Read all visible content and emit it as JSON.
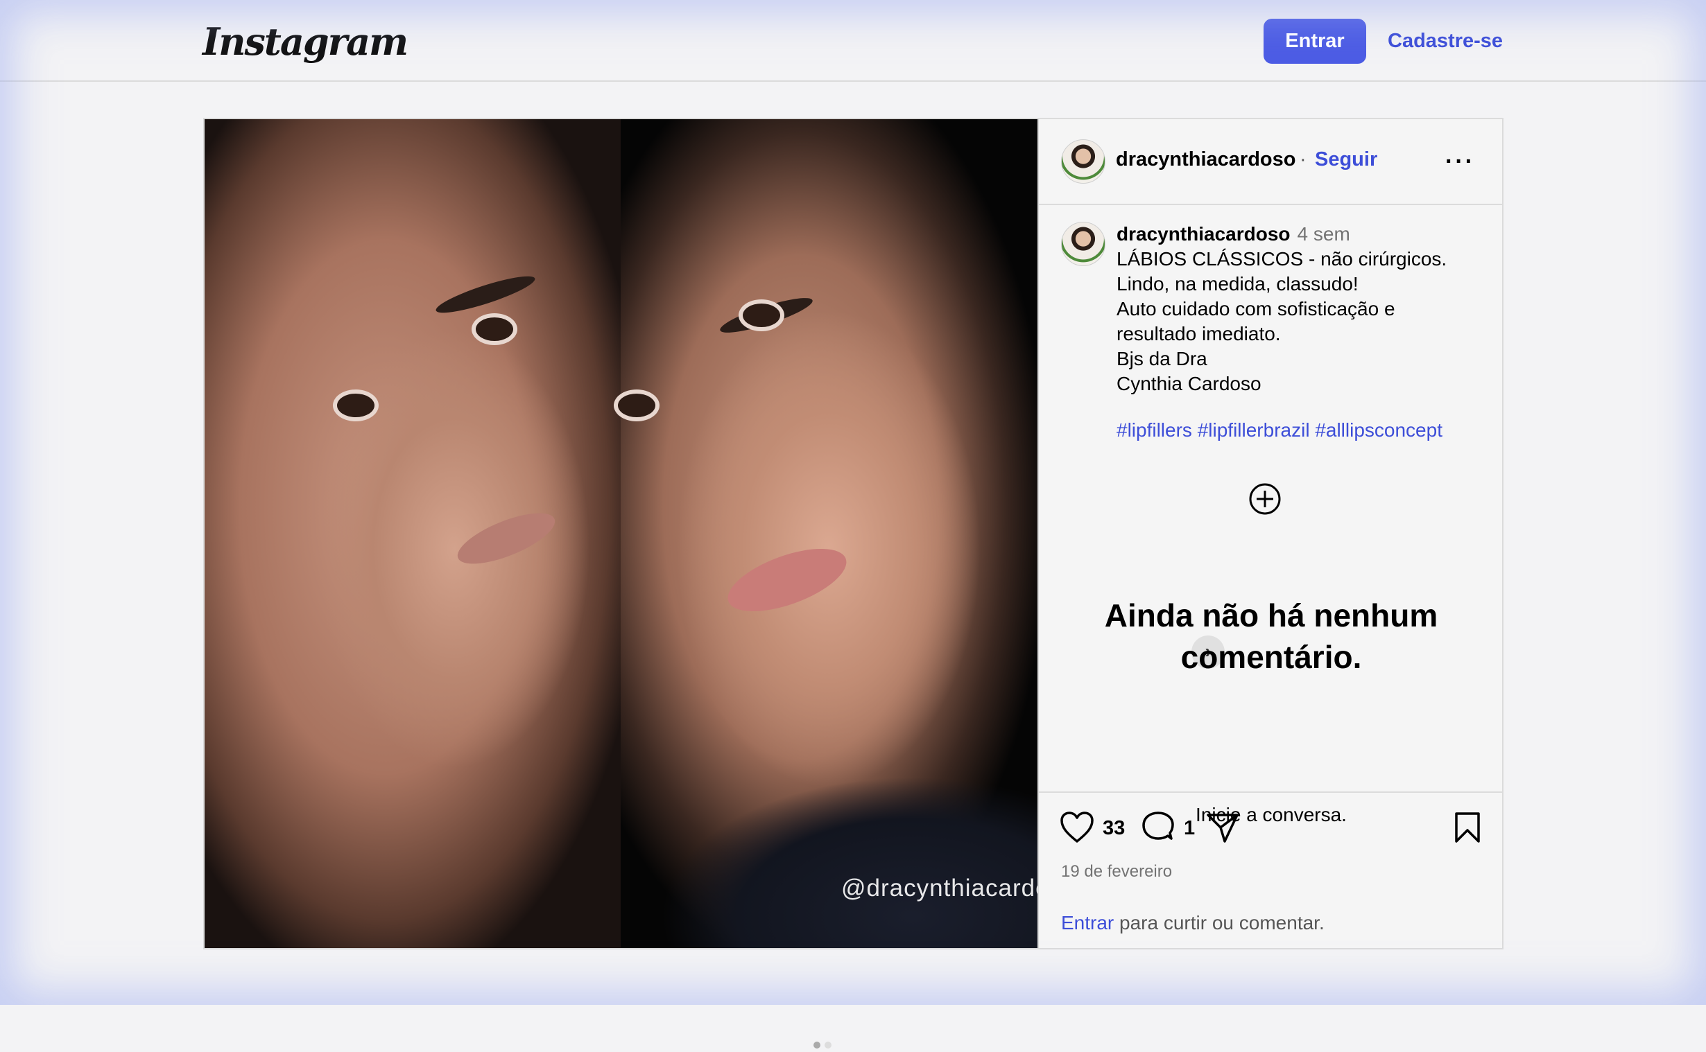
{
  "header": {
    "logo": "Instagram",
    "login_label": "Entrar",
    "signup_label": "Cadastre-se"
  },
  "post": {
    "username": "dracynthiacardoso",
    "separator": "·",
    "follow_label": "Seguir",
    "more_label": "···",
    "watermark": "@dracynthiacardoso",
    "carousel": {
      "total": 2,
      "current": 1
    },
    "caption": {
      "username": "dracynthiacardoso",
      "time": "4 sem",
      "lines": [
        "LÁBIOS CLÁSSICOS - não cirúrgicos.",
        "Lindo, na medida, classudo!",
        "Auto cuidado com sofisticação e",
        "resultado imediato.",
        "Bjs da Dra",
        "Cynthia Cardoso"
      ],
      "hashtags": "#lipfillers #lipfillerbrazil #alllipsconcept"
    },
    "empty_comments": {
      "title": "Ainda não há nenhum comentário.",
      "subtitle": "Inicie a conversa."
    },
    "likes": "33",
    "comments": "1",
    "date": "19 de fevereiro",
    "login_prompt": {
      "link": "Entrar",
      "text": " para curtir ou comentar."
    }
  },
  "colors": {
    "accent": "#4c5ce4",
    "link": "#3d4ed8",
    "muted": "#737373",
    "border": "#dbdbdb"
  },
  "icons": [
    "heart-icon",
    "comment-icon",
    "share-icon",
    "bookmark-icon",
    "add-circle-icon",
    "more-icon",
    "chevron-right-icon"
  ]
}
